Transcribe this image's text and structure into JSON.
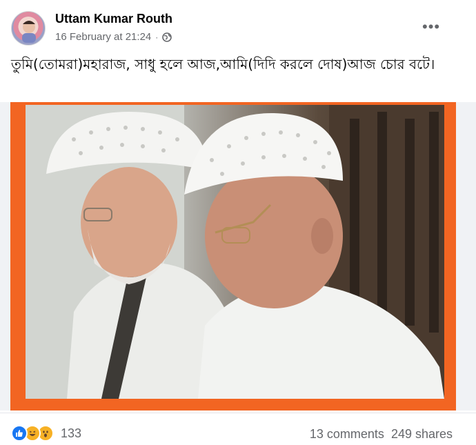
{
  "post": {
    "author": "Uttam Kumar Routh",
    "timestamp": "16 February at 21:24",
    "separator": "·",
    "privacy_icon": "globe-icon",
    "more_icon": "more-options-icon",
    "more_label": "•••",
    "text": "তুমি(তোমরা)মহারাজ, সাধু হলে আজ,আমি(দিদি করলে দোষ)আজ চোর বটে।"
  },
  "footer": {
    "reaction_icons": [
      "like-icon",
      "haha-icon",
      "wow-icon"
    ],
    "reaction_count": "133",
    "comments": "13 comments",
    "shares": "249 shares"
  },
  "colors": {
    "frame_orange": "#f26522",
    "like_blue": "#1877f2",
    "reaction_yellow": "#f7b125",
    "meta_grey": "#65676b"
  }
}
